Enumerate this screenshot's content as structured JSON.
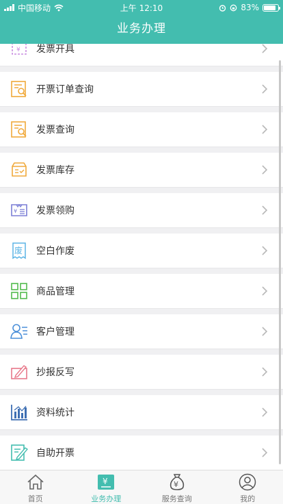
{
  "status_bar": {
    "carrier": "中国移动",
    "time": "上午 12:10",
    "battery": "83%",
    "battery_level": 0.83
  },
  "header": {
    "title": "业务办理"
  },
  "menu": {
    "items": [
      {
        "label": "发票开具",
        "icon": "invoice-issue-icon",
        "color": "#c98de0"
      },
      {
        "label": "开票订单查询",
        "icon": "order-search-icon",
        "color": "#f0a93a"
      },
      {
        "label": "发票查询",
        "icon": "invoice-search-icon",
        "color": "#f0a93a"
      },
      {
        "label": "发票库存",
        "icon": "inventory-box-icon",
        "color": "#f0a93a"
      },
      {
        "label": "发票领购",
        "icon": "invoice-purchase-icon",
        "color": "#7b7fd6"
      },
      {
        "label": "空白作废",
        "icon": "void-icon",
        "color": "#5bb4e5",
        "glyph": "废"
      },
      {
        "label": "商品管理",
        "icon": "grid-icon",
        "color": "#5cbf57"
      },
      {
        "label": "客户管理",
        "icon": "customer-icon",
        "color": "#4a8fd9"
      },
      {
        "label": "抄报反写",
        "icon": "report-icon",
        "color": "#e8788a"
      },
      {
        "label": "资料统计",
        "icon": "bar-chart-icon",
        "color": "#3e6fb3"
      },
      {
        "label": "自助开票",
        "icon": "self-invoice-icon",
        "color": "#43bdaf"
      }
    ]
  },
  "tabbar": {
    "tabs": [
      {
        "label": "首页",
        "icon": "home-icon"
      },
      {
        "label": "业务办理",
        "icon": "business-icon",
        "glyph": "¥"
      },
      {
        "label": "服务查询",
        "icon": "money-bag-icon",
        "glyph": "¥"
      },
      {
        "label": "我的",
        "icon": "user-icon"
      }
    ],
    "active": "业务办理"
  },
  "colors": {
    "accent": "#43bdaf"
  }
}
